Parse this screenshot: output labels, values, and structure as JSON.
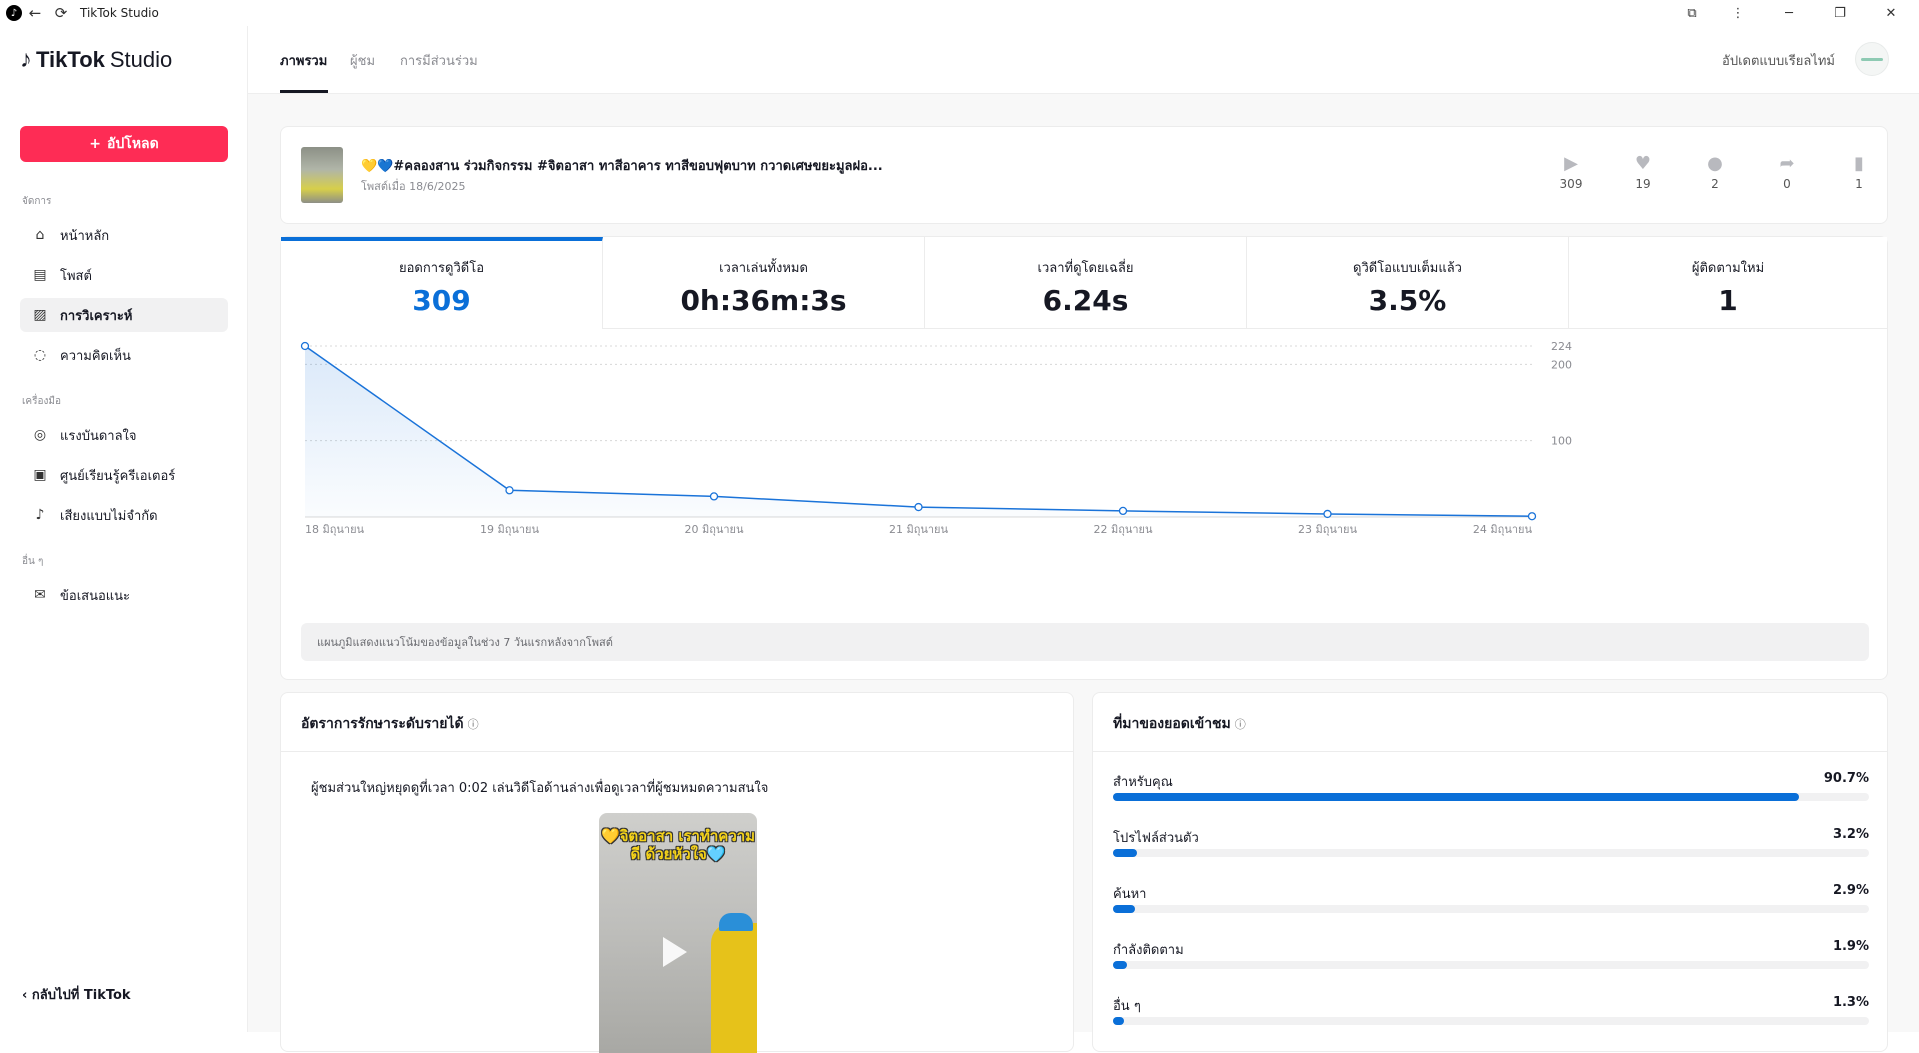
{
  "window": {
    "title": "TikTok Studio",
    "icons": [
      "tiktok-logo-icon",
      "back-icon",
      "refresh-icon",
      "extensions-icon",
      "more-icon",
      "minimize-icon",
      "restore-icon",
      "close-icon"
    ]
  },
  "sidebar": {
    "brand_bold": "TikTok",
    "brand_rest": "Studio",
    "upload_label": "อัปโหลด",
    "sections": [
      {
        "title": "จัดการ",
        "items": [
          {
            "label": "หน้าหลัก",
            "icon": "home-icon"
          },
          {
            "label": "โพสต์",
            "icon": "posts-icon"
          },
          {
            "label": "การวิเคราะห์",
            "icon": "analytics-icon",
            "active": true
          },
          {
            "label": "ความคิดเห็น",
            "icon": "comments-icon"
          }
        ]
      },
      {
        "title": "เครื่องมือ",
        "items": [
          {
            "label": "แรงบันดาลใจ",
            "icon": "lightbulb-icon"
          },
          {
            "label": "ศูนย์เรียนรู้ครีเอเตอร์",
            "icon": "book-icon"
          },
          {
            "label": "เสียงแบบไม่จำกัด",
            "icon": "music-note-icon"
          }
        ]
      },
      {
        "title": "อื่น ๆ",
        "items": [
          {
            "label": "ข้อเสนอแนะ",
            "icon": "mail-icon"
          }
        ]
      }
    ],
    "back_label": "กลับไปที่ TikTok"
  },
  "header": {
    "tabs": [
      "ภาพรวม",
      "ผู้ชม",
      "การมีส่วนร่วม"
    ],
    "active_tab": 0,
    "realtime_label": "อัปเดตแบบเรียลไทม์"
  },
  "post": {
    "title": "💛💙#คลองสาน ร่วมกิจกรรม #จิตอาสา ทาสีอาคาร ทาสีขอบฟุตบาท กวาดเศษขยะมูลฝอ...",
    "date": "โพสต์เมื่อ 18/6/2025",
    "stats": [
      {
        "icon": "play-icon",
        "value": "309"
      },
      {
        "icon": "heart-icon",
        "value": "19"
      },
      {
        "icon": "comment-icon",
        "value": "2"
      },
      {
        "icon": "share-icon",
        "value": "0"
      },
      {
        "icon": "bookmark-icon",
        "value": "1"
      }
    ]
  },
  "metrics": [
    {
      "label": "ยอดการดูวิดีโอ",
      "value": "309",
      "active": true
    },
    {
      "label": "เวลาเล่นทั้งหมด",
      "value": "0h:36m:3s"
    },
    {
      "label": "เวลาที่ดูโดยเฉลี่ย",
      "value": "6.24s"
    },
    {
      "label": "ดูวิดีโอแบบเต็มแล้ว",
      "value": "3.5%"
    },
    {
      "label": "ผู้ติดตามใหม่",
      "value": "1"
    }
  ],
  "chart_data": {
    "type": "area",
    "categories": [
      "18 มิถุนายน",
      "19 มิถุนายน",
      "20 มิถุนายน",
      "21 มิถุนายน",
      "22 มิถุนายน",
      "23 มิถุนายน",
      "24 มิถุนายน"
    ],
    "series": [
      {
        "values": [
          224,
          35,
          27,
          13,
          8,
          4,
          1
        ]
      }
    ],
    "y_ticks": [
      "224",
      "200",
      "100"
    ],
    "ylim": [
      0,
      224
    ],
    "color": "#1a73d9",
    "grid": true,
    "note": "แผนภูมิแสดงแนวโน้มของข้อมูลในช่วง 7 วันแรกหลังจากโพสต์"
  },
  "retention": {
    "title": "อัตราการรักษาระดับรายได้",
    "text": "ผู้ชมส่วนใหญ่หยุดดูที่เวลา 0:02 เล่นวิดีโอด้านล่างเพื่อดูเวลาที่ผู้ชมหมดความสนใจ",
    "video_caption": "💛จิตอาสา เราทำความดี ด้วยหัวใจ🩵"
  },
  "traffic_sources": {
    "title": "ที่มาของยอดเข้าชม",
    "items": [
      {
        "label": "สำหรับคุณ",
        "percent": "90.7%",
        "value": 90.7
      },
      {
        "label": "โปรไฟล์ส่วนตัว",
        "percent": "3.2%",
        "value": 3.2
      },
      {
        "label": "ค้นหา",
        "percent": "2.9%",
        "value": 2.9
      },
      {
        "label": "กำลังติดตาม",
        "percent": "1.9%",
        "value": 1.9
      },
      {
        "label": "อื่น ๆ",
        "percent": "1.3%",
        "value": 1.3
      }
    ]
  }
}
